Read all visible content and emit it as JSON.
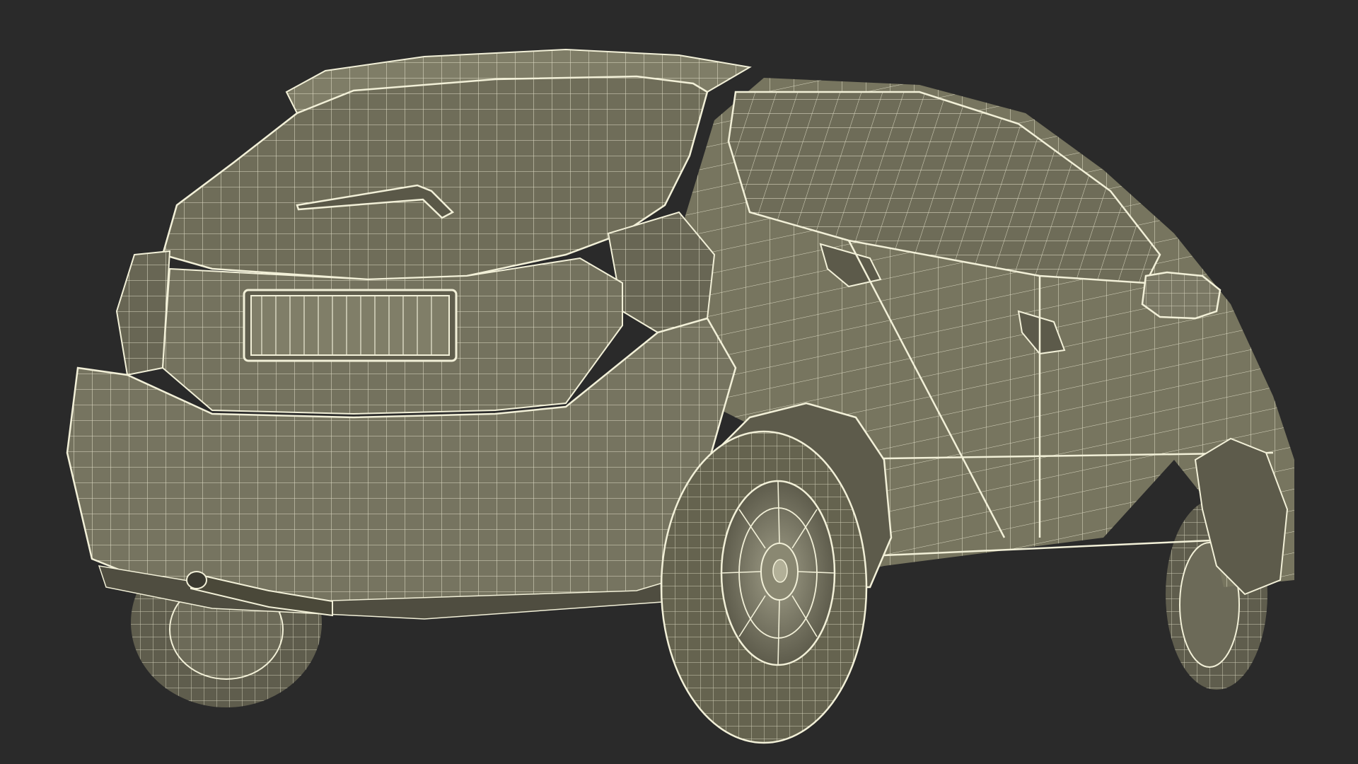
{
  "scene": {
    "background_color": "#2a2a2a",
    "surface_color": "#74725f",
    "surface_shadow_color": "#5d5b4b",
    "surface_light_color": "#888670",
    "wire_color": "#f2f0d8",
    "dark_color": "#3a392f",
    "subject": "car-wireframe-rear-three-quarter"
  }
}
